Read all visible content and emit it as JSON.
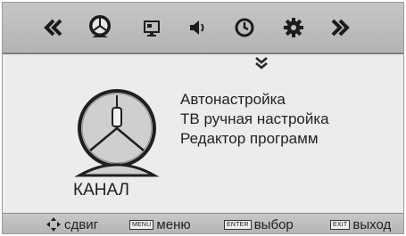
{
  "topbar": {
    "items": [
      {
        "icon": "double-chevron-left-icon"
      },
      {
        "icon": "satellite-dish-icon",
        "selected": true
      },
      {
        "icon": "picture-icon"
      },
      {
        "icon": "speaker-icon"
      },
      {
        "icon": "clock-icon"
      },
      {
        "icon": "gear-icon"
      },
      {
        "icon": "double-chevron-right-icon"
      }
    ]
  },
  "main": {
    "section_title": "КАНАЛ",
    "section_icon": "channel-antenna-icon",
    "menu_items": [
      {
        "label": "Автонастройка"
      },
      {
        "label": "ТВ ручная настройка"
      },
      {
        "label": "Редактор программ"
      }
    ],
    "more_indicator_icon": "double-chevron-down-icon"
  },
  "bottombar": {
    "hints": [
      {
        "key": "",
        "icon": "four-way-arrows-icon",
        "label": "сдвиг"
      },
      {
        "key": "MENU",
        "label": "меню"
      },
      {
        "key": "ENTER",
        "label": "выбор"
      },
      {
        "key": "EXIT",
        "label": "выход"
      }
    ]
  },
  "colors": {
    "bar_background": "#bdbdbd",
    "panel_background": "#ececec",
    "text": "#222222"
  }
}
